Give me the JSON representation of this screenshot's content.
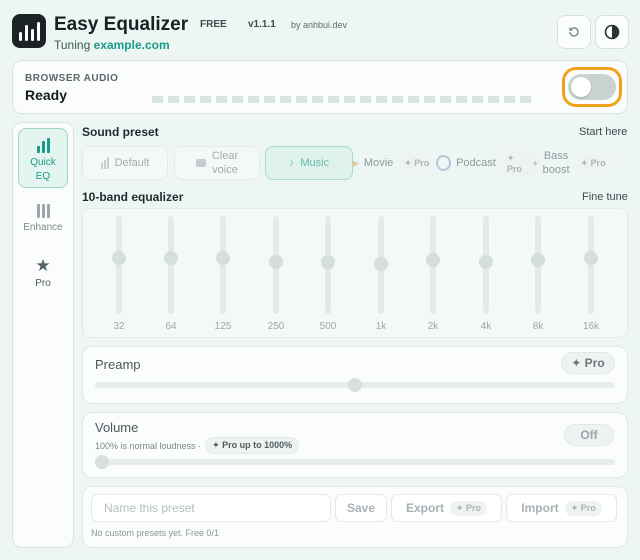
{
  "app": {
    "title": "Easy Equalizer",
    "badge": "FREE",
    "version": "v1.1.1",
    "author": "by anhbui.dev",
    "tuning_prefix": "Tuning",
    "tuning_site": "example.com"
  },
  "audio": {
    "label": "BROWSER AUDIO",
    "status": "Ready",
    "enabled": false
  },
  "sidenav": [
    {
      "label_1": "Quick",
      "label_2": "EQ",
      "icon": "bars-icon",
      "active": true
    },
    {
      "label_1": "Enhance",
      "icon": "sliders-icon",
      "active": false
    },
    {
      "label_1": "Pro",
      "icon": "star-icon",
      "active": false
    }
  ],
  "preset": {
    "title": "Sound preset",
    "right": "Start here",
    "chips": [
      {
        "label": "Default"
      },
      {
        "label_1": "Clear",
        "label_2": "voice"
      },
      {
        "label": "Music",
        "selected": true
      },
      {
        "label": "Movie",
        "pro": "✦ Pro"
      },
      {
        "label": "Podcast",
        "pro": "✦ Pro"
      },
      {
        "label_1": "Bass",
        "label_2": "boost",
        "pro": "✦ Pro"
      }
    ]
  },
  "eq": {
    "title": "10-band equalizer",
    "right": "Fine tune",
    "bands": [
      {
        "freq": "32",
        "level": 0.0
      },
      {
        "freq": "64",
        "level": 0.0
      },
      {
        "freq": "125",
        "level": 0.0
      },
      {
        "freq": "250",
        "level": -0.1
      },
      {
        "freq": "500",
        "level": -0.1
      },
      {
        "freq": "1k",
        "level": -0.15
      },
      {
        "freq": "2k",
        "level": -0.05
      },
      {
        "freq": "4k",
        "level": -0.1
      },
      {
        "freq": "8k",
        "level": -0.05
      },
      {
        "freq": "16k",
        "level": 0.0
      }
    ]
  },
  "preamp": {
    "title": "Preamp",
    "pro": "✦ Pro",
    "level": 0.5
  },
  "volume": {
    "title": "Volume",
    "note": "100% is normal loudness ·",
    "pro": "✦ Pro up to 1000%",
    "button": "Off",
    "level": 0.0
  },
  "save": {
    "placeholder": "Name this preset",
    "save": "Save",
    "export": "Export",
    "import": "Import",
    "pro": "✦ Pro",
    "hint": "No custom presets yet. Free 0/1"
  }
}
